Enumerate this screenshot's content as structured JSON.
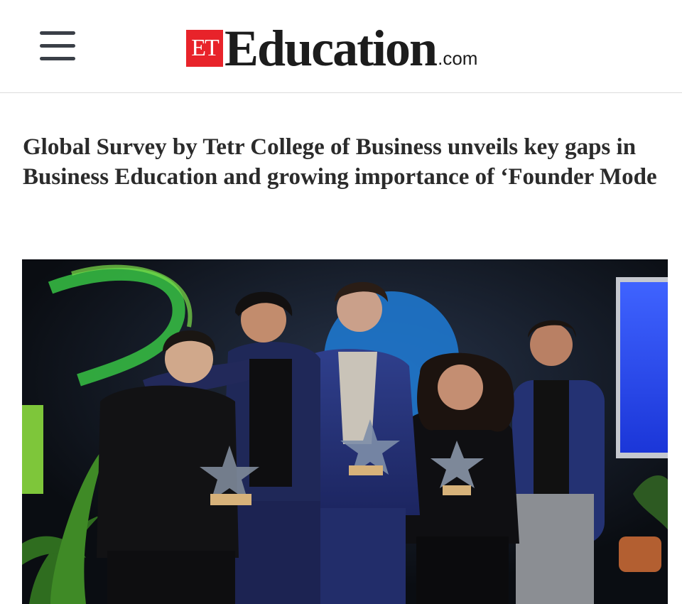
{
  "header": {
    "menu_icon": "hamburger-menu-icon",
    "logo": {
      "badge": "ET",
      "word": "Education",
      "tld": ".com"
    }
  },
  "article": {
    "headline": "Global Survey by Tetr College of Business unveils key gaps in Business Education and growing importance of ‘Founder Mode"
  },
  "photo": {
    "description_icon": "award-group-photo"
  },
  "colors": {
    "brand_red": "#e8232a",
    "text_dark": "#2b2b2b",
    "divider": "#dcdcdc"
  }
}
